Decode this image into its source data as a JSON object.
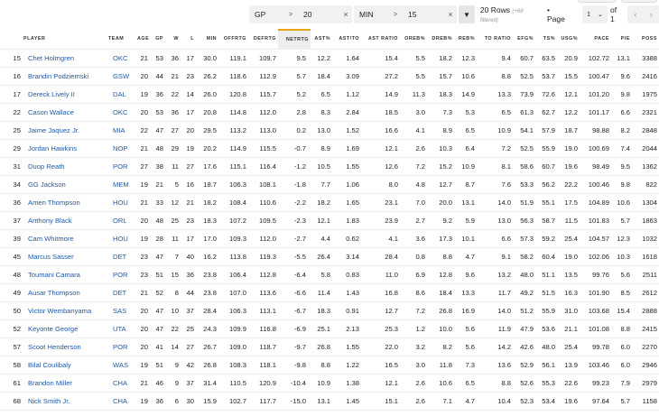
{
  "filters": [
    {
      "field": "GP",
      "op": ">",
      "value": "20"
    },
    {
      "field": "MIN",
      "op": ">",
      "value": "15"
    }
  ],
  "summary": {
    "rows": "20 Rows",
    "filtered": "(+68 filtered)",
    "page_label": "• Page",
    "page": "1",
    "of": "of 1"
  },
  "icons": {
    "clear": "×",
    "filter": "▼",
    "chevron": "⌄",
    "prev": "‹",
    "next": "›"
  },
  "columns": [
    "",
    "PLAYER",
    "TEAM",
    "AGE",
    "GP",
    "W",
    "L",
    "MIN",
    "OFFRTG",
    "DEFRTG",
    "NETRTG",
    "AST%",
    "AST/TO",
    "AST RATIO",
    "OREB%",
    "DREB%",
    "REB%",
    "TO RATIO",
    "EFG%",
    "TS%",
    "USG%",
    "PACE",
    "PIE",
    "POSS"
  ],
  "active_sort_column": "NETRTG",
  "rows": [
    [
      "15",
      "Chet Holmgren",
      "OKC",
      "21",
      "53",
      "36",
      "17",
      "30.0",
      "119.1",
      "109.7",
      "9.5",
      "12.2",
      "1.64",
      "15.4",
      "5.5",
      "18.2",
      "12.3",
      "9.4",
      "60.7",
      "63.5",
      "20.9",
      "102.72",
      "13.1",
      "3388"
    ],
    [
      "16",
      "Brandin Podziemski",
      "GSW",
      "20",
      "44",
      "21",
      "23",
      "26.2",
      "118.6",
      "112.9",
      "5.7",
      "18.4",
      "3.09",
      "27.2",
      "5.5",
      "15.7",
      "10.6",
      "8.8",
      "52.5",
      "53.7",
      "15.5",
      "100.47",
      "9.6",
      "2416"
    ],
    [
      "17",
      "Dereck Lively II",
      "DAL",
      "19",
      "36",
      "22",
      "14",
      "26.0",
      "120.8",
      "115.7",
      "5.2",
      "6.5",
      "1.12",
      "14.9",
      "11.3",
      "18.3",
      "14.9",
      "13.3",
      "73.9",
      "72.6",
      "12.1",
      "101.20",
      "9.8",
      "1975"
    ],
    [
      "22",
      "Cason Wallace",
      "OKC",
      "20",
      "53",
      "36",
      "17",
      "20.8",
      "114.8",
      "112.0",
      "2.8",
      "8.3",
      "2.84",
      "18.5",
      "3.0",
      "7.3",
      "5.3",
      "6.5",
      "61.3",
      "62.7",
      "12.2",
      "101.17",
      "6.6",
      "2321"
    ],
    [
      "25",
      "Jaime Jaquez Jr.",
      "MIA",
      "22",
      "47",
      "27",
      "20",
      "29.5",
      "113.2",
      "113.0",
      "0.2",
      "13.0",
      "1.52",
      "16.6",
      "4.1",
      "8.9",
      "6.5",
      "10.9",
      "54.1",
      "57.9",
      "18.7",
      "98.88",
      "8.2",
      "2848"
    ],
    [
      "29",
      "Jordan Hawkins",
      "NOP",
      "21",
      "48",
      "29",
      "19",
      "20.2",
      "114.9",
      "115.5",
      "-0.7",
      "8.9",
      "1.69",
      "12.1",
      "2.6",
      "10.3",
      "6.4",
      "7.2",
      "52.5",
      "55.9",
      "19.0",
      "100.69",
      "7.4",
      "2044"
    ],
    [
      "31",
      "Duop Reath",
      "POR",
      "27",
      "38",
      "11",
      "27",
      "17.6",
      "115.1",
      "116.4",
      "-1.2",
      "10.5",
      "1.55",
      "12.6",
      "7.2",
      "15.2",
      "10.9",
      "8.1",
      "58.6",
      "60.7",
      "19.6",
      "98.49",
      "9.5",
      "1362"
    ],
    [
      "34",
      "GG Jackson",
      "MEM",
      "19",
      "21",
      "5",
      "16",
      "18.7",
      "106.3",
      "108.1",
      "-1.8",
      "7.7",
      "1.06",
      "8.0",
      "4.8",
      "12.7",
      "8.7",
      "7.6",
      "53.3",
      "56.2",
      "22.2",
      "100.46",
      "9.8",
      "822"
    ],
    [
      "36",
      "Amen Thompson",
      "HOU",
      "21",
      "33",
      "12",
      "21",
      "18.2",
      "108.4",
      "110.6",
      "-2.2",
      "18.2",
      "1.65",
      "23.1",
      "7.0",
      "20.0",
      "13.1",
      "14.0",
      "51.9",
      "55.1",
      "17.5",
      "104.89",
      "10.6",
      "1304"
    ],
    [
      "37",
      "Anthony Black",
      "ORL",
      "20",
      "48",
      "25",
      "23",
      "18.3",
      "107.2",
      "109.5",
      "-2.3",
      "12.1",
      "1.83",
      "23.9",
      "2.7",
      "9.2",
      "5.9",
      "13.0",
      "56.3",
      "58.7",
      "11.5",
      "101.83",
      "5.7",
      "1863"
    ],
    [
      "39",
      "Cam Whitmore",
      "HOU",
      "19",
      "28",
      "11",
      "17",
      "17.0",
      "109.3",
      "112.0",
      "-2.7",
      "4.4",
      "0.62",
      "4.1",
      "3.6",
      "17.3",
      "10.1",
      "6.6",
      "57.3",
      "59.2",
      "25.4",
      "104.57",
      "12.3",
      "1032"
    ],
    [
      "45",
      "Marcus Sasser",
      "DET",
      "23",
      "47",
      "7",
      "40",
      "16.2",
      "113.8",
      "119.3",
      "-5.5",
      "26.4",
      "3.14",
      "28.4",
      "0.8",
      "8.8",
      "4.7",
      "9.1",
      "58.2",
      "60.4",
      "19.0",
      "102.06",
      "10.3",
      "1618"
    ],
    [
      "48",
      "Toumani Camara",
      "POR",
      "23",
      "51",
      "15",
      "36",
      "23.8",
      "106.4",
      "112.8",
      "-6.4",
      "5.8",
      "0.83",
      "11.0",
      "6.9",
      "12.8",
      "9.6",
      "13.2",
      "48.0",
      "51.1",
      "13.5",
      "99.76",
      "5.6",
      "2511"
    ],
    [
      "49",
      "Ausar Thompson",
      "DET",
      "21",
      "52",
      "8",
      "44",
      "23.8",
      "107.0",
      "113.6",
      "-6.6",
      "11.4",
      "1.43",
      "16.8",
      "8.6",
      "18.4",
      "13.3",
      "11.7",
      "49.2",
      "51.5",
      "16.3",
      "101.90",
      "8.5",
      "2612"
    ],
    [
      "50",
      "Victor Wembanyama",
      "SAS",
      "20",
      "47",
      "10",
      "37",
      "28.4",
      "106.3",
      "113.1",
      "-6.7",
      "18.3",
      "0.91",
      "12.7",
      "7.2",
      "26.8",
      "16.9",
      "14.0",
      "51.2",
      "55.9",
      "31.0",
      "103.68",
      "15.4",
      "2888"
    ],
    [
      "52",
      "Keyonte George",
      "UTA",
      "20",
      "47",
      "22",
      "25",
      "24.3",
      "109.9",
      "116.8",
      "-6.9",
      "25.1",
      "2.13",
      "25.3",
      "1.2",
      "10.0",
      "5.6",
      "11.9",
      "47.9",
      "53.6",
      "21.1",
      "101.08",
      "8.8",
      "2415"
    ],
    [
      "57",
      "Scoot Henderson",
      "POR",
      "20",
      "41",
      "14",
      "27",
      "26.7",
      "109.0",
      "118.7",
      "-9.7",
      "26.8",
      "1.55",
      "22.0",
      "3.2",
      "8.2",
      "5.6",
      "14.2",
      "42.6",
      "48.0",
      "25.4",
      "99.78",
      "6.0",
      "2270"
    ],
    [
      "58",
      "Bilal Coulibaly",
      "WAS",
      "19",
      "51",
      "9",
      "42",
      "26.8",
      "108.3",
      "118.1",
      "-9.8",
      "8.8",
      "1.22",
      "16.5",
      "3.0",
      "11.8",
      "7.3",
      "13.6",
      "52.9",
      "56.1",
      "13.9",
      "103.46",
      "6.0",
      "2946"
    ],
    [
      "61",
      "Brandon Miller",
      "CHA",
      "21",
      "46",
      "9",
      "37",
      "31.4",
      "110.5",
      "120.9",
      "-10.4",
      "10.9",
      "1.38",
      "12.1",
      "2.6",
      "10.6",
      "6.5",
      "8.8",
      "52.6",
      "55.3",
      "22.6",
      "99.23",
      "7.9",
      "2979"
    ],
    [
      "68",
      "Nick Smith Jr.",
      "CHA",
      "19",
      "36",
      "6",
      "30",
      "15.9",
      "102.7",
      "117.7",
      "-15.0",
      "13.1",
      "1.45",
      "15.1",
      "2.6",
      "7.1",
      "4.7",
      "10.4",
      "52.3",
      "53.4",
      "19.6",
      "97.64",
      "5.7",
      "1158"
    ]
  ]
}
